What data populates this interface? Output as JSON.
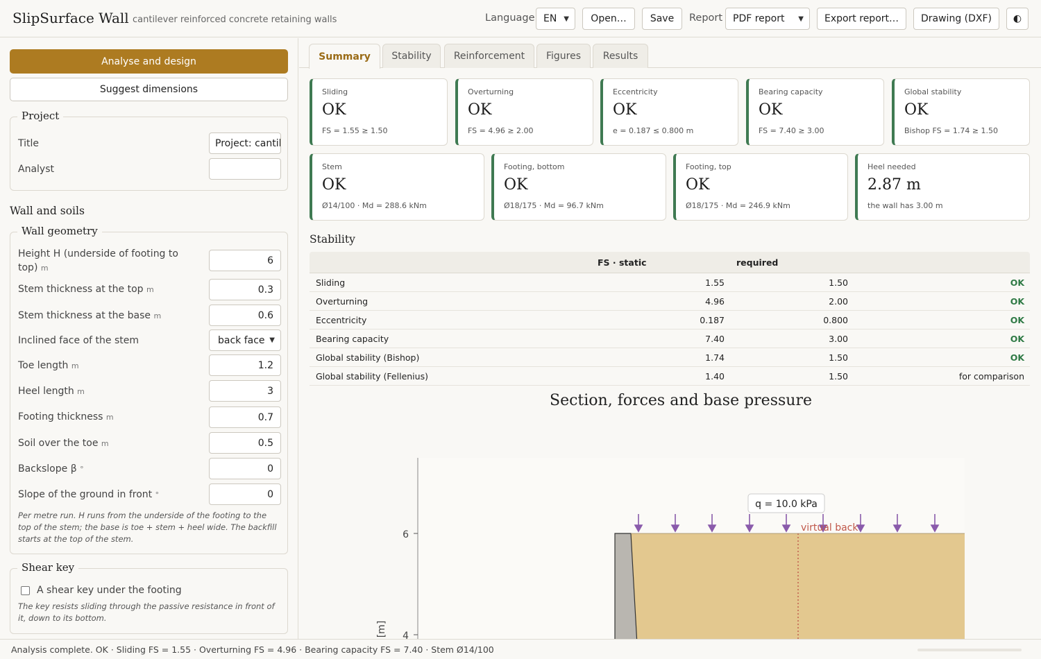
{
  "app": {
    "title": "SlipSurface Wall",
    "subtitle": "cantilever reinforced concrete retaining walls"
  },
  "toolbar": {
    "language_label": "Language",
    "language_value": "EN",
    "open_label": "Open…",
    "save_label": "Save",
    "report_label": "Report",
    "report_value": "PDF report",
    "export_label": "Export report…",
    "drawing_label": "Drawing (DXF)",
    "theme_icon": "◐"
  },
  "sidebar": {
    "analyse_label": "Analyse and design",
    "suggest_label": "Suggest dimensions",
    "project": {
      "legend": "Project",
      "title_label": "Title",
      "title_value": "Project: cantilever wall",
      "analyst_label": "Analyst",
      "analyst_value": ""
    },
    "wall_soils_heading": "Wall and soils",
    "geometry": {
      "legend": "Wall geometry",
      "rows": [
        {
          "label": "Height H (underside of footing to top)",
          "unit": "m",
          "value": "6"
        },
        {
          "label": "Stem thickness at the top",
          "unit": "m",
          "value": "0.3"
        },
        {
          "label": "Stem thickness at the base",
          "unit": "m",
          "value": "0.6"
        },
        {
          "label": "Inclined face of the stem",
          "unit": "",
          "value": "back face"
        },
        {
          "label": "Toe length",
          "unit": "m",
          "value": "1.2"
        },
        {
          "label": "Heel length",
          "unit": "m",
          "value": "3"
        },
        {
          "label": "Footing thickness",
          "unit": "m",
          "value": "0.7"
        },
        {
          "label": "Soil over the toe",
          "unit": "m",
          "value": "0.5"
        },
        {
          "label": "Backslope β",
          "unit": "°",
          "value": "0"
        },
        {
          "label": "Slope of the ground in front",
          "unit": "°",
          "value": "0"
        }
      ],
      "note": "Per metre run. H runs from the underside of the footing to the top of the stem; the base is toe + stem + heel wide. The backfill starts at the top of the stem."
    },
    "shear_key": {
      "legend": "Shear key",
      "checkbox_label": "A shear key under the footing",
      "checked": false,
      "note": "The key resists sliding through the passive resistance in front of it, down to its bottom."
    }
  },
  "tabs": [
    "Summary",
    "Stability",
    "Reinforcement",
    "Figures",
    "Results"
  ],
  "active_tab": "Summary",
  "cards_row1": [
    {
      "label": "Sliding",
      "value": "OK",
      "detail": "FS = 1.55 ≥ 1.50"
    },
    {
      "label": "Overturning",
      "value": "OK",
      "detail": "FS = 4.96 ≥ 2.00"
    },
    {
      "label": "Eccentricity",
      "value": "OK",
      "detail": "e = 0.187 ≤ 0.800 m"
    },
    {
      "label": "Bearing capacity",
      "value": "OK",
      "detail": "FS = 7.40 ≥ 3.00"
    },
    {
      "label": "Global stability",
      "value": "OK",
      "detail": "Bishop FS = 1.74 ≥ 1.50"
    }
  ],
  "cards_row2": [
    {
      "label": "Stem",
      "value": "OK",
      "detail": "Ø14/100 · Md = 288.6 kNm"
    },
    {
      "label": "Footing, bottom",
      "value": "OK",
      "detail": "Ø18/175 · Md = 96.7 kNm"
    },
    {
      "label": "Footing, top",
      "value": "OK",
      "detail": "Ø18/175 · Md = 246.9 kNm"
    },
    {
      "label": "Heel needed",
      "value": "2.87 m",
      "detail": "the wall has 3.00 m"
    }
  ],
  "stability": {
    "heading": "Stability",
    "columns": [
      "",
      "FS · static",
      "required",
      ""
    ],
    "rows": [
      {
        "name": "Sliding",
        "fs": "1.55",
        "required": "1.50",
        "status": "OK"
      },
      {
        "name": "Overturning",
        "fs": "4.96",
        "required": "2.00",
        "status": "OK"
      },
      {
        "name": "Eccentricity",
        "fs": "0.187",
        "required": "0.800",
        "status": "OK"
      },
      {
        "name": "Bearing capacity",
        "fs": "7.40",
        "required": "3.00",
        "status": "OK"
      },
      {
        "name": "Global stability (Bishop)",
        "fs": "1.74",
        "required": "1.50",
        "status": "OK"
      },
      {
        "name": "Global stability (Fellenius)",
        "fs": "1.40",
        "required": "1.50",
        "status": "for comparison"
      }
    ]
  },
  "figure": {
    "title": "Section, forces and base pressure",
    "surcharge_label": "q = 10.0 kPa",
    "virtual_back_label": "virtual back",
    "y_axis_label": "[m]",
    "y_ticks": [
      "6",
      "4"
    ],
    "colors": {
      "soil": "#e3c88f",
      "concrete": "#b9b6b0",
      "load": "#8a5bab",
      "virtual": "#c0584a",
      "ok": "#3f7a52",
      "accent": "#ad7b21"
    }
  },
  "status": {
    "text": "Analysis complete. OK · Sliding FS = 1.55 · Overturning FS = 4.96 · Bearing capacity FS = 7.40 · Stem Ø14/100"
  }
}
